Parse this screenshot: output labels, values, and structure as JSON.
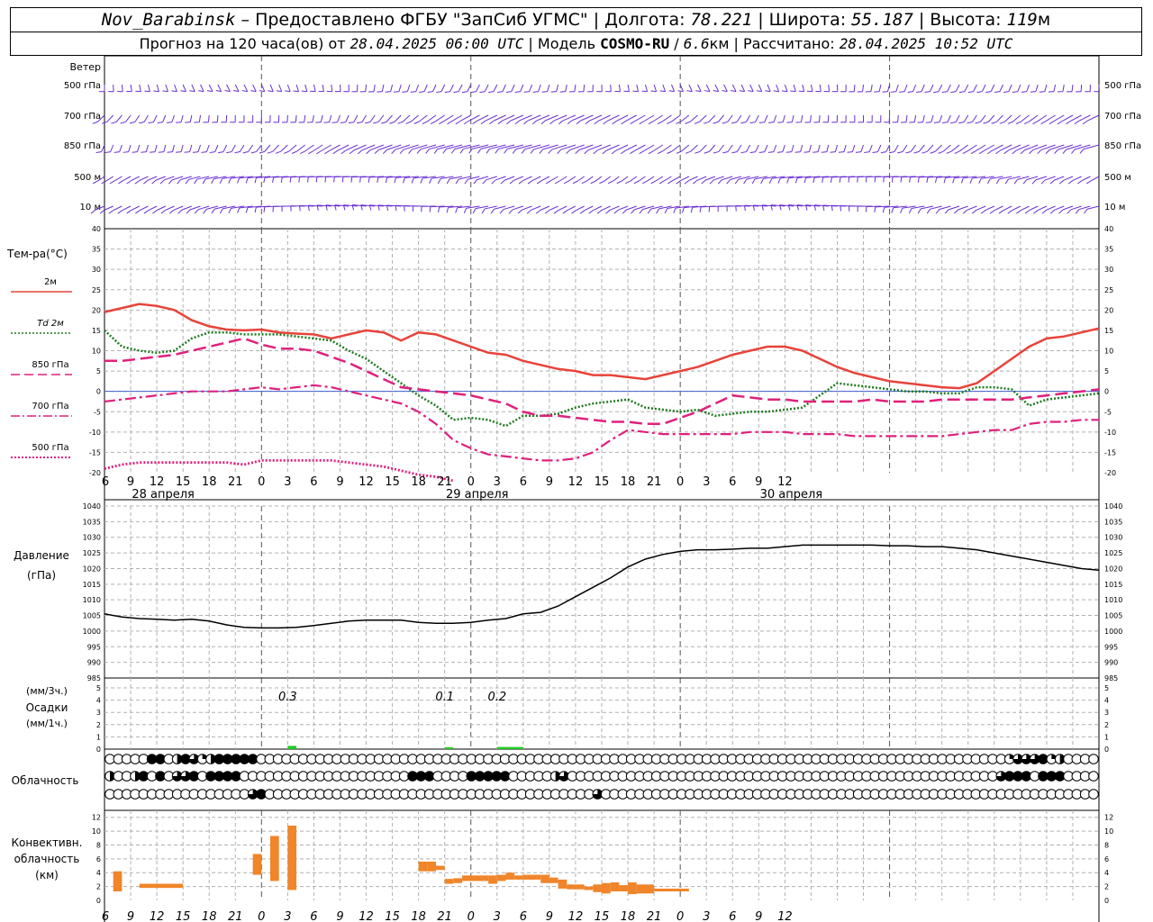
{
  "header": {
    "station": "Nov_Barabinsk",
    "provider": " – Предоставлено ФГБУ \"ЗапСиб УГМС\" | ",
    "lon_label": "Долгота: ",
    "lon": "78.221",
    "lat_label": " | Широта: ",
    "lat": "55.187",
    "alt_label": " | Высота: ",
    "alt": "119",
    "alt_unit": "м",
    "forecast_label": "Прогноз на 120 часа(ов) от ",
    "forecast_start": "28.04.2025 06:00 UTC",
    "model_label": " | Модель ",
    "model": "COSMO-RU",
    "res_sep": " / ",
    "res": "6.6",
    "res_unit": "км",
    "calc_label": " | Рассчитано: ",
    "calc_time": "28.04.2025 10:52 UTC"
  },
  "wind_panel": {
    "title": "Ветер",
    "levels": [
      "500 гПа",
      "700 гПа",
      "850 гПа",
      "500 м",
      "10 м"
    ]
  },
  "temp_panel": {
    "title": "Тем-ра(°С)",
    "legend": [
      {
        "label": "2м",
        "color": "#e8433a",
        "style": "solid"
      },
      {
        "label": "Td  2м",
        "color": "#1f7a1f",
        "style": "dotted"
      },
      {
        "label": "850 гПа",
        "color": "#e0207c",
        "style": "dashed"
      },
      {
        "label": "700 гПа",
        "color": "#e0207c",
        "style": "dashdot"
      },
      {
        "label": "500 гПа",
        "color": "#e0207c",
        "style": "dotted"
      }
    ],
    "yticks": [
      40,
      35,
      30,
      25,
      20,
      15,
      10,
      5,
      0,
      -5,
      -10,
      -15,
      -20
    ]
  },
  "time_axis": {
    "hour_labels": [
      "6",
      "9",
      "12",
      "15",
      "18",
      "21",
      "0",
      "3",
      "6",
      "9",
      "12",
      "15",
      "18",
      "21",
      "0",
      "3",
      "6",
      "9",
      "12",
      "15",
      "18",
      "21",
      "0",
      "3",
      "6",
      "9",
      "12"
    ],
    "dates": [
      {
        "label": "28 апреля",
        "hour_index": 2
      },
      {
        "label": "29 апреля",
        "hour_index": 14
      },
      {
        "label": "30 апреля",
        "hour_index": 26
      }
    ]
  },
  "pressure_panel": {
    "title": "Давление",
    "unit": "(гПа)",
    "yticks": [
      1040,
      1035,
      1030,
      1025,
      1020,
      1015,
      1010,
      1005,
      1000,
      995,
      990,
      985
    ]
  },
  "precip_panel": {
    "unit_top": "(мм/3ч.)",
    "title": "Осадки",
    "unit_bottom": "(мм/1ч.)",
    "yticks": [
      5,
      4,
      3,
      2,
      1,
      0
    ],
    "annotations": [
      {
        "hour": 21,
        "text": "0.3"
      },
      {
        "hour": 39,
        "text": "0.1"
      },
      {
        "hour": 45,
        "text": "0.2"
      }
    ]
  },
  "cloud_panel": {
    "title": "Облачность"
  },
  "conv_panel": {
    "title_lines": [
      "Конвективн.",
      "облачность",
      "(км)"
    ],
    "yticks": [
      12,
      10,
      8,
      6,
      4,
      2,
      0
    ]
  },
  "chart_data": [
    {
      "type": "line",
      "title": "Тем-ра(°С)",
      "x_unit": "hours from 28.04.2025 06:00 UTC",
      "ylim": [
        -20,
        40
      ],
      "grid": true,
      "series": [
        {
          "name": "2м",
          "color": "#e8433a",
          "x": [
            0,
            2,
            4,
            6,
            8,
            10,
            12,
            14,
            16,
            18,
            20,
            22,
            24,
            26,
            28,
            30,
            32,
            34,
            36,
            38,
            40,
            42,
            44,
            46,
            48,
            50,
            52,
            54,
            56,
            58,
            60,
            62,
            64,
            66,
            68,
            70,
            72,
            74,
            76,
            78,
            80,
            82,
            84,
            86,
            88,
            90,
            92,
            94,
            96,
            98,
            100,
            102,
            104,
            106,
            108,
            110,
            112,
            114
          ],
          "y": [
            19.5,
            20.5,
            21.5,
            21,
            20,
            17.5,
            16,
            15.2,
            15,
            15.2,
            14.5,
            14.2,
            14,
            13,
            14,
            15,
            14.5,
            12.5,
            14.5,
            14,
            12.5,
            11,
            9.5,
            9,
            7.5,
            6.5,
            5.5,
            5,
            4,
            4,
            3.5,
            3,
            4,
            5,
            6,
            7.5,
            9,
            10,
            11,
            11,
            10,
            8,
            6,
            4.5,
            3.5,
            2.5,
            2,
            1.5,
            1,
            0.8,
            2,
            5,
            8,
            11,
            13,
            13.5,
            14.5,
            15.5
          ]
        },
        {
          "name": "Td  2м",
          "color": "#1f7a1f",
          "x": [
            0,
            2,
            4,
            6,
            8,
            10,
            12,
            14,
            16,
            18,
            20,
            22,
            24,
            26,
            28,
            30,
            32,
            34,
            36,
            38,
            40,
            42,
            44,
            46,
            48,
            50,
            52,
            54,
            56,
            58,
            60,
            62,
            64,
            66,
            68,
            70,
            72,
            74,
            76,
            78,
            80,
            82,
            84,
            86,
            88,
            90,
            92,
            94,
            96,
            98,
            100,
            102,
            104,
            106,
            108,
            110,
            112,
            114
          ],
          "y": [
            15,
            11,
            10,
            9.5,
            10,
            13,
            14.5,
            14.5,
            14,
            14,
            14,
            13.5,
            13,
            12.5,
            10,
            8,
            5,
            2,
            -1,
            -3.5,
            -7,
            -6.5,
            -7,
            -8.5,
            -6,
            -6,
            -5.5,
            -4,
            -3,
            -2.5,
            -2,
            -4,
            -4.5,
            -5,
            -4.5,
            -6,
            -5.5,
            -5,
            -5,
            -4.5,
            -4,
            -1,
            2,
            1.5,
            1,
            0.5,
            0,
            0,
            -0.5,
            -0.5,
            1,
            1,
            0.5,
            -3.5,
            -2,
            -1.5,
            -1,
            -0.5
          ]
        },
        {
          "name": "850 гПа",
          "color": "#e0207c",
          "x": [
            0,
            2,
            4,
            6,
            8,
            10,
            12,
            14,
            16,
            18,
            20,
            22,
            24,
            26,
            28,
            30,
            32,
            34,
            36,
            38,
            40,
            42,
            44,
            46,
            48,
            50,
            52,
            54,
            56,
            58,
            60,
            62,
            64,
            66,
            68,
            70,
            72,
            74,
            76,
            78,
            80,
            82,
            84,
            86,
            88,
            90,
            92,
            94,
            96,
            98,
            100,
            102,
            104,
            106,
            108,
            110,
            112,
            114
          ],
          "y": [
            7.5,
            7.5,
            8,
            8.5,
            9,
            10,
            11,
            12,
            13,
            11.5,
            10.5,
            10.5,
            10,
            8.5,
            7,
            5,
            3,
            1,
            0.5,
            0,
            -0.5,
            -1,
            -2,
            -3,
            -5,
            -6,
            -6,
            -6.5,
            -7,
            -7.5,
            -7.5,
            -8,
            -8,
            -6.5,
            -5,
            -3,
            -1,
            -1.5,
            -2,
            -2,
            -2.5,
            -2.5,
            -2.5,
            -2.5,
            -2,
            -2.5,
            -2.5,
            -2.5,
            -2,
            -2,
            -2,
            -2,
            -2,
            -1.5,
            -1,
            -0.5,
            0,
            0.5
          ]
        },
        {
          "name": "700 гПа",
          "color": "#e0207c",
          "x": [
            0,
            2,
            4,
            6,
            8,
            10,
            12,
            14,
            16,
            18,
            20,
            22,
            24,
            26,
            28,
            30,
            32,
            34,
            36,
            38,
            40,
            42,
            44,
            46,
            48,
            50,
            52,
            54,
            56,
            58,
            60,
            62,
            64,
            66,
            68,
            70,
            72,
            74,
            76,
            78,
            80,
            82,
            84,
            86,
            88,
            90,
            92,
            94,
            96,
            98,
            100,
            102,
            104,
            106,
            108,
            110,
            112,
            114
          ],
          "y": [
            -2.5,
            -2,
            -1.5,
            -1,
            -0.5,
            0,
            0,
            0,
            0.5,
            1,
            0.5,
            1,
            1.5,
            1,
            0,
            -1,
            -2,
            -3,
            -5,
            -8,
            -12,
            -14,
            -15.5,
            -16,
            -16.5,
            -17,
            -17,
            -16.5,
            -15,
            -12,
            -9.5,
            -10,
            -10.5,
            -10.5,
            -10.5,
            -10.5,
            -10.5,
            -10,
            -10,
            -10,
            -10.5,
            -10.5,
            -10.5,
            -11,
            -11,
            -11,
            -11,
            -11,
            -11,
            -10.5,
            -10,
            -9.5,
            -9.5,
            -8,
            -7.5,
            -7.5,
            -7,
            -7
          ]
        },
        {
          "name": "500 гПа",
          "color": "#e0207c",
          "x": [
            0,
            2,
            4,
            6,
            8,
            10,
            12,
            14,
            16,
            18,
            20,
            22,
            24,
            26,
            28,
            30,
            32,
            34,
            36,
            38,
            40
          ],
          "y": [
            -19,
            -18,
            -17.5,
            -17.5,
            -17.5,
            -17.5,
            -17.5,
            -17.5,
            -18,
            -17,
            -17,
            -17,
            -17,
            -17,
            -17.5,
            -18,
            -18.5,
            -19.5,
            -20.5,
            -21,
            -22
          ]
        }
      ]
    },
    {
      "type": "line",
      "title": "Давление",
      "x_unit": "hours from 28.04.2025 06:00 UTC",
      "ylim": [
        985,
        1040
      ],
      "grid": true,
      "series": [
        {
          "name": "Давление",
          "color": "#000000",
          "x": [
            0,
            2,
            4,
            6,
            8,
            10,
            12,
            14,
            16,
            18,
            20,
            22,
            24,
            26,
            28,
            30,
            32,
            34,
            36,
            38,
            40,
            42,
            44,
            46,
            48,
            50,
            52,
            54,
            56,
            58,
            60,
            62,
            64,
            66,
            68,
            70,
            72,
            74,
            76,
            78,
            80,
            82,
            84,
            86,
            88,
            90,
            92,
            94,
            96,
            98,
            100,
            102,
            104,
            106,
            108,
            110,
            112,
            114
          ],
          "y": [
            1005.5,
            1004.5,
            1004,
            1003.8,
            1003.5,
            1003.8,
            1003.2,
            1002,
            1001.2,
            1001,
            1001,
            1001.2,
            1001.8,
            1002.5,
            1003.2,
            1003.5,
            1003.5,
            1003.5,
            1002.8,
            1002.5,
            1002.5,
            1002.8,
            1003.5,
            1004,
            1005.5,
            1006,
            1008,
            1011,
            1014,
            1017,
            1020.5,
            1023,
            1024.5,
            1025.5,
            1026,
            1026,
            1026.2,
            1026.5,
            1026.5,
            1027,
            1027.5,
            1027.5,
            1027.5,
            1027.5,
            1027.5,
            1027.3,
            1027.3,
            1027,
            1027,
            1026.5,
            1026,
            1025,
            1024,
            1023,
            1022,
            1021,
            1020,
            1019.5
          ]
        }
      ]
    },
    {
      "type": "bar",
      "title": "Осадки",
      "x_unit": "hours from 28.04.2025 06:00 UTC",
      "ylim": [
        0,
        5
      ],
      "series": [
        {
          "name": "Осадки",
          "color": "#22cc22",
          "bars": [
            {
              "x0": 21,
              "x1": 22,
              "value": 0.3
            },
            {
              "x0": 39,
              "x1": 40,
              "value": 0.1
            },
            {
              "x0": 45,
              "x1": 48,
              "value": 0.2
            }
          ]
        }
      ]
    },
    {
      "type": "table",
      "title": "Облачность",
      "x_unit": "hour index (1 h steps) from 28.04.2025 06:00 UTC",
      "encoding": "0 empty, 1 quarter, 2 half, 3 three-quarter, 4 full",
      "rows": [
        "0000044024312444440000000000000000000000000000000000000000000000000000000000000000000000000000000000000000013334120000",
        "2002404033404444000000000000000000004440000444440000023000000000000000000000000000000000000000000000000000344404440000",
        "0000000000000000034000000000000000000000000000000000000000300000000000000000000000000000000000000000000000000000000000"
      ]
    },
    {
      "type": "bar",
      "title": "Конвективн. облачность",
      "x_unit": "hours from 28.04.2025 06:00 UTC",
      "ylim": [
        0,
        13
      ],
      "series": [
        {
          "name": "Конвективн. облачность",
          "color": "#f0852a",
          "bars": [
            {
              "x0": 1,
              "x1": 2,
              "base": 1.3,
              "top": 4.2
            },
            {
              "x0": 4,
              "x1": 9,
              "base": 1.8,
              "top": 2.4
            },
            {
              "x0": 17,
              "x1": 18,
              "base": 3.7,
              "top": 6.7
            },
            {
              "x0": 19,
              "x1": 20,
              "base": 2.8,
              "top": 9.3
            },
            {
              "x0": 21,
              "x1": 22,
              "base": 1.5,
              "top": 10.8
            },
            {
              "x0": 36,
              "x1": 37,
              "base": 4.2,
              "top": 5.6
            },
            {
              "x0": 37,
              "x1": 38,
              "base": 4.2,
              "top": 5.6
            },
            {
              "x0": 38,
              "x1": 39,
              "base": 4.4,
              "top": 5.0
            },
            {
              "x0": 39,
              "x1": 40,
              "base": 2.4,
              "top": 3.1
            },
            {
              "x0": 40,
              "x1": 41,
              "base": 2.5,
              "top": 3.2
            },
            {
              "x0": 41,
              "x1": 44,
              "base": 2.8,
              "top": 3.6
            },
            {
              "x0": 44,
              "x1": 45,
              "base": 2.4,
              "top": 3.6
            },
            {
              "x0": 45,
              "x1": 46,
              "base": 2.8,
              "top": 3.7
            },
            {
              "x0": 46,
              "x1": 47,
              "base": 3.0,
              "top": 4.0
            },
            {
              "x0": 47,
              "x1": 48,
              "base": 3.0,
              "top": 3.6
            },
            {
              "x0": 48,
              "x1": 50,
              "base": 3.0,
              "top": 3.7
            },
            {
              "x0": 50,
              "x1": 51,
              "base": 2.5,
              "top": 3.7
            },
            {
              "x0": 51,
              "x1": 52,
              "base": 2.5,
              "top": 3.3
            },
            {
              "x0": 52,
              "x1": 53,
              "base": 1.7,
              "top": 3.0
            },
            {
              "x0": 53,
              "x1": 55,
              "base": 1.6,
              "top": 2.3
            },
            {
              "x0": 55,
              "x1": 56,
              "base": 1.5,
              "top": 2.0
            },
            {
              "x0": 56,
              "x1": 57,
              "base": 1.2,
              "top": 2.3
            },
            {
              "x0": 57,
              "x1": 58,
              "base": 1.0,
              "top": 2.5
            },
            {
              "x0": 58,
              "x1": 59,
              "base": 1.3,
              "top": 2.6
            },
            {
              "x0": 59,
              "x1": 60,
              "base": 1.3,
              "top": 2.2
            },
            {
              "x0": 60,
              "x1": 61,
              "base": 0.9,
              "top": 2.6
            },
            {
              "x0": 61,
              "x1": 63,
              "base": 1.0,
              "top": 2.3
            },
            {
              "x0": 63,
              "x1": 67,
              "base": 1.3,
              "top": 1.7
            }
          ]
        }
      ]
    }
  ]
}
